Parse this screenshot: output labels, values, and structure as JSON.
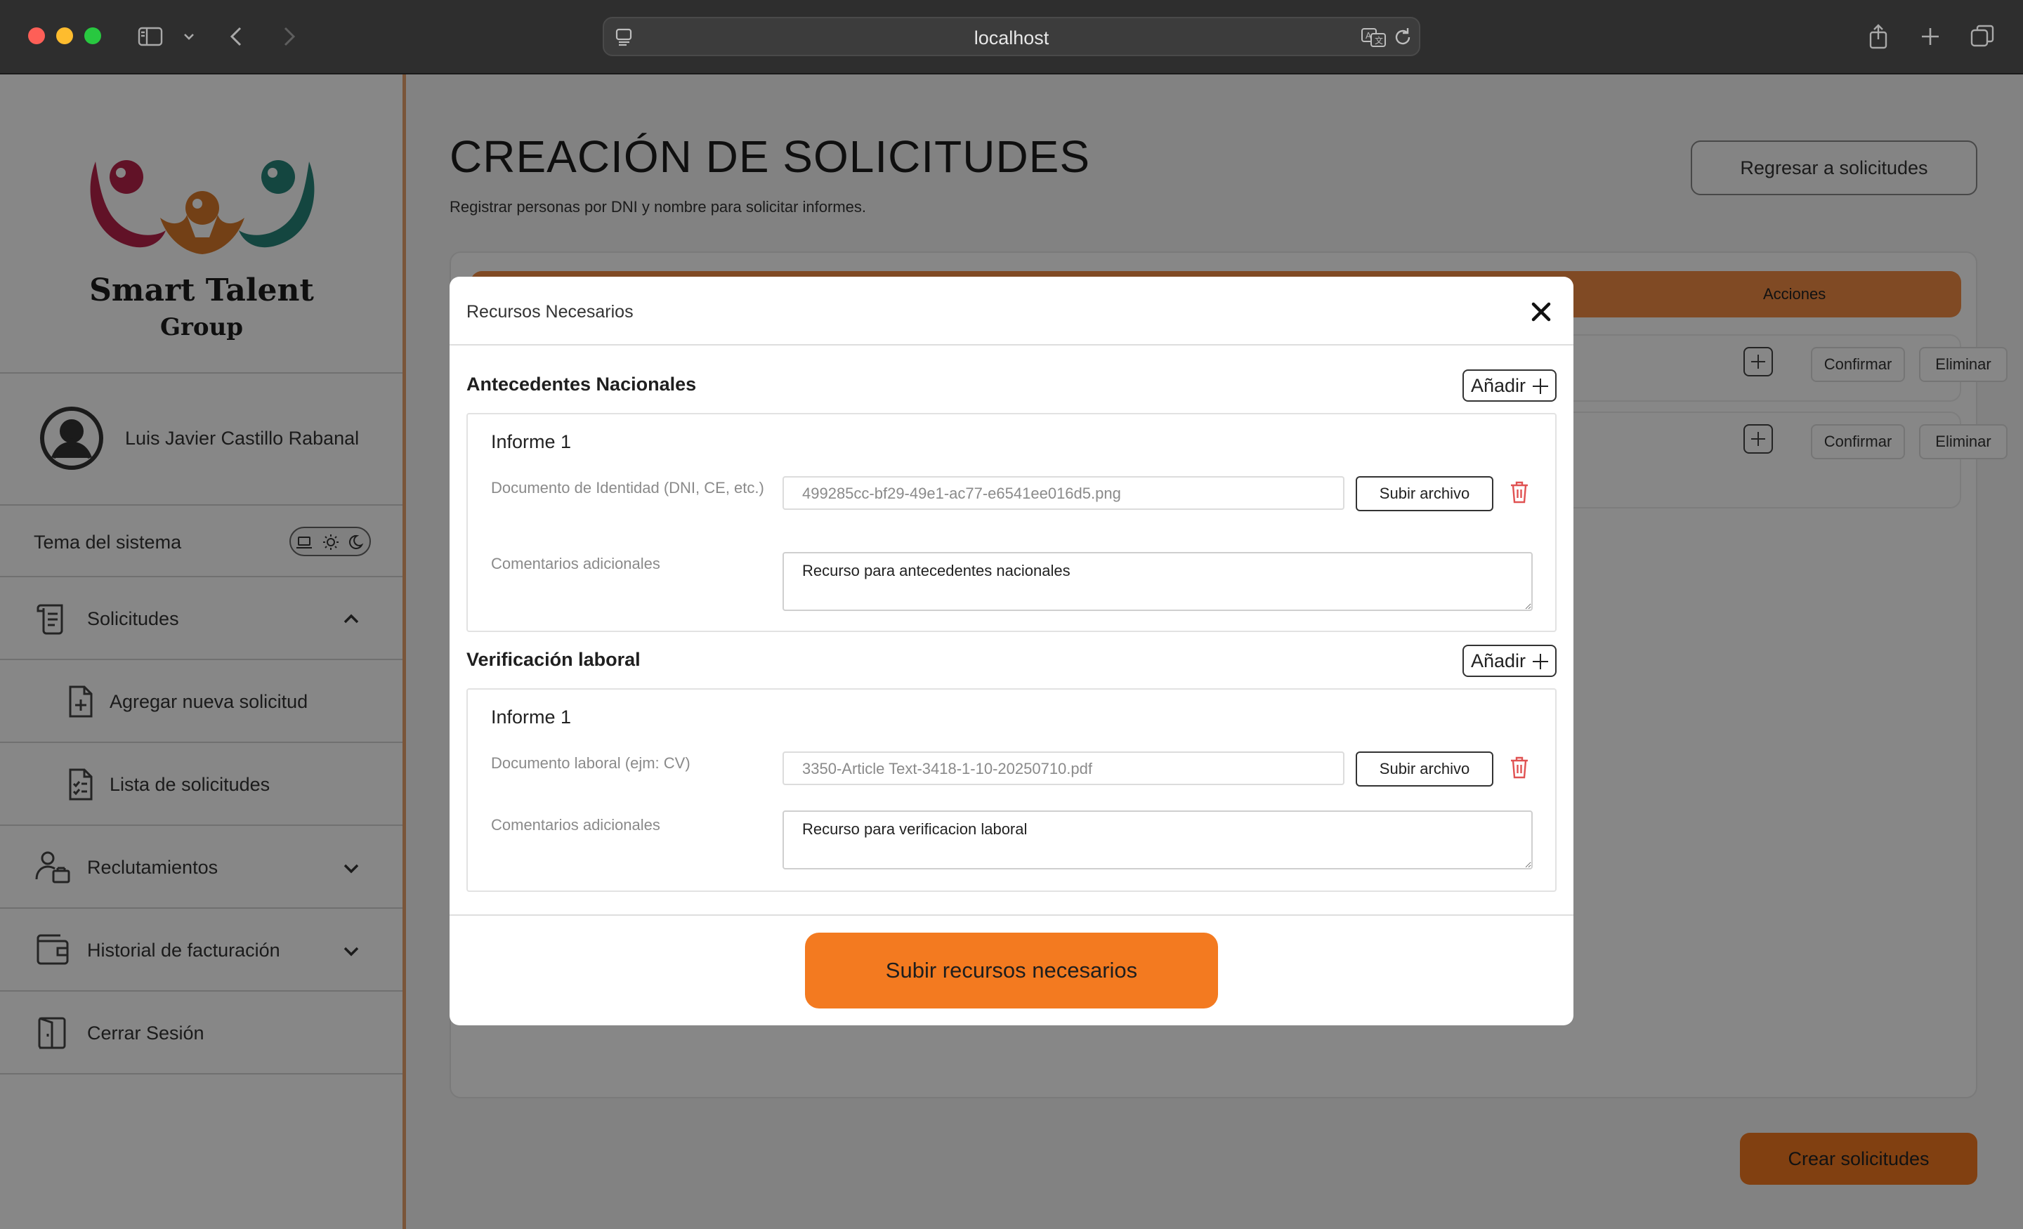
{
  "browser": {
    "url": "localhost"
  },
  "sidebar": {
    "brand_line1": "Smart Talent",
    "brand_line2": "Group",
    "user_name": "Luis Javier Castillo Rabanal",
    "theme_label": "Tema del sistema",
    "nav": {
      "solicitudes": "Solicitudes",
      "agregar": "Agregar nueva solicitud",
      "lista": "Lista de solicitudes",
      "reclutamientos": "Reclutamientos",
      "historial": "Historial de facturación",
      "cerrar": "Cerrar Sesión"
    }
  },
  "main": {
    "title": "CREACIÓN DE SOLICITUDES",
    "subtitle": "Registrar personas por DNI y nombre para solicitar informes.",
    "back_button": "Regresar a solicitudes",
    "table": {
      "actions_header": "Acciones",
      "rows": [
        {
          "confirm": "Confirmar",
          "delete": "Eliminar"
        },
        {
          "confirm": "Confirmar",
          "delete": "Eliminar"
        }
      ]
    },
    "create_button": "Crear solicitudes"
  },
  "modal": {
    "title": "Recursos Necesarios",
    "sections": [
      {
        "title": "Antecedentes Nacionales",
        "add_label": "Añadir",
        "informe": "Informe 1",
        "doc_label": "Documento de Identidad (DNI, CE, etc.)",
        "file_value": "499285cc-bf29-49e1-ac77-e6541ee016d5.png",
        "upload_label": "Subir archivo",
        "comment_label": "Comentarios adicionales",
        "comment_value": "Recurso para antecedentes nacionales"
      },
      {
        "title": "Verificación laboral",
        "add_label": "Añadir",
        "informe": "Informe 1",
        "doc_label": "Documento laboral (ejm: CV)",
        "file_value": "3350-Article Text-3418-1-10-20250710.pdf",
        "upload_label": "Subir archivo",
        "comment_label": "Comentarios adicionales",
        "comment_value": "Recurso para verificacion laboral"
      }
    ],
    "submit_label": "Subir recursos necesarios"
  },
  "colors": {
    "accent": "#f37a20",
    "table_header": "#f28d45",
    "sidebar_border": "#e7a06c",
    "trash": "#e05252",
    "logo_red": "#b8234a",
    "logo_orange": "#d9792a",
    "logo_teal": "#27847a"
  }
}
